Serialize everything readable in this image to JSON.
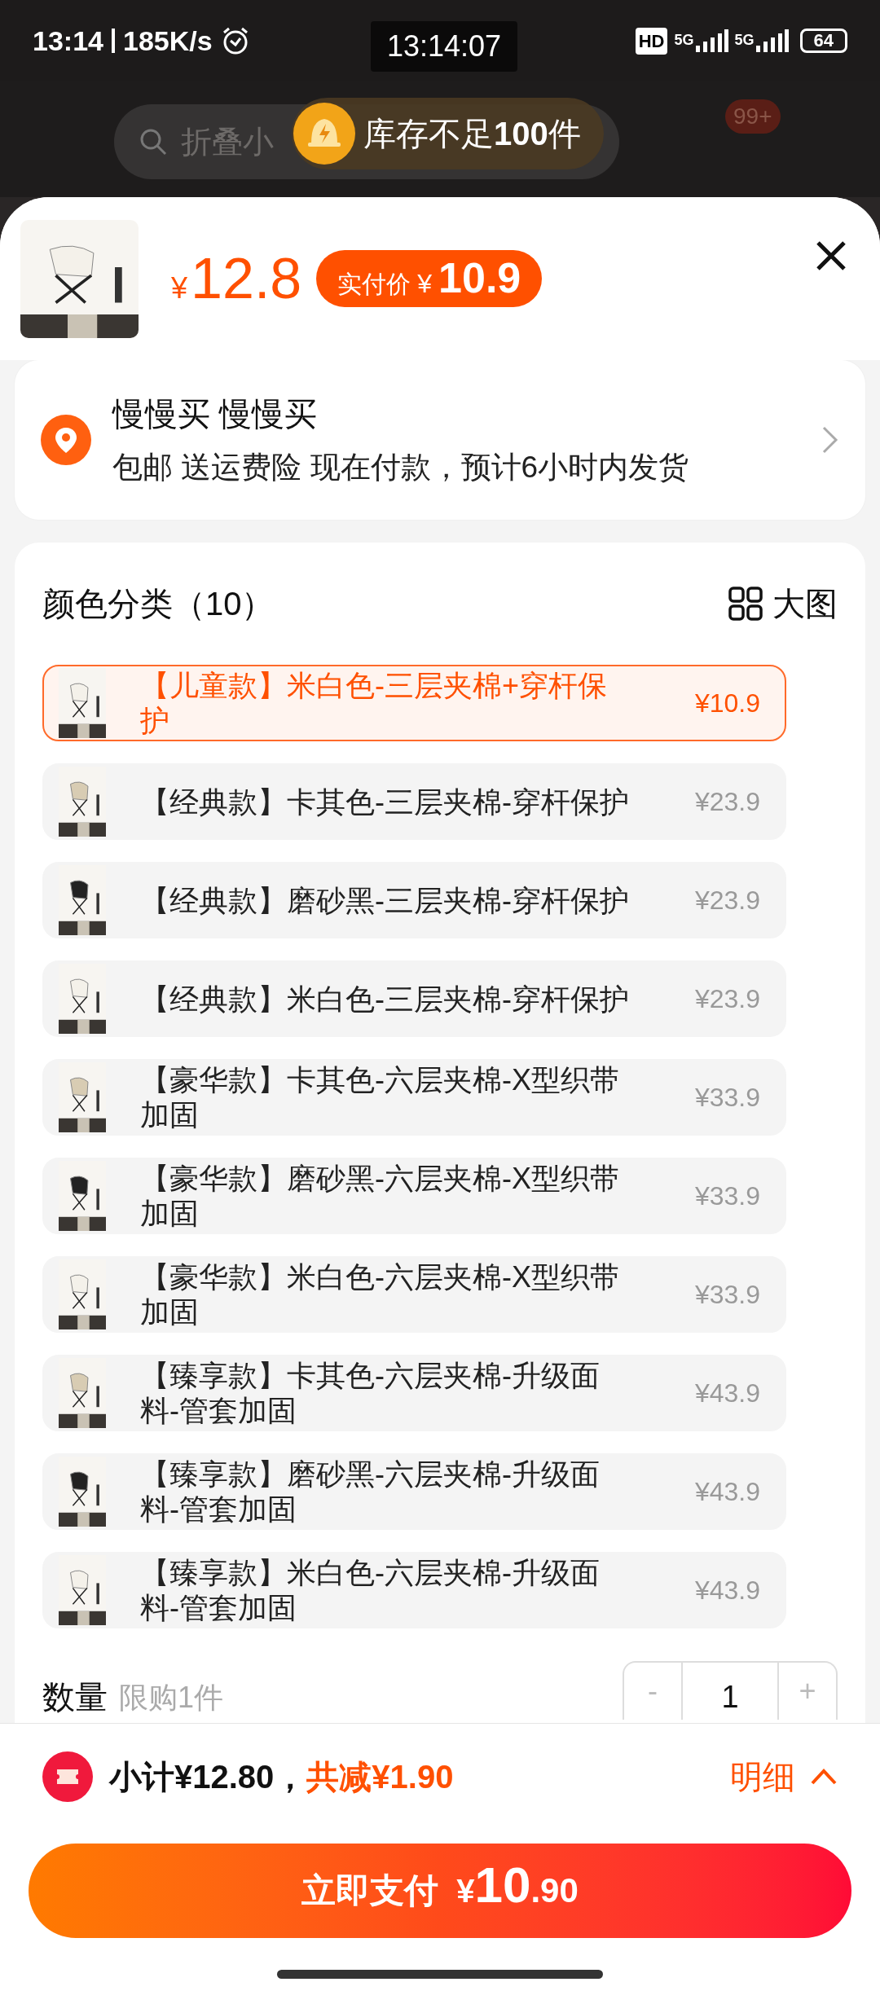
{
  "status_bar": {
    "time": "13:14",
    "speed": "185K/s",
    "clock": "13:14:07",
    "hd": "HD",
    "networks": [
      "5G",
      "5G"
    ],
    "battery": "64"
  },
  "background": {
    "search_text": "折叠小",
    "badge": "99+"
  },
  "toast": {
    "text": "库存不足**100**件"
  },
  "header": {
    "price_symbol": "¥",
    "price": "12.8",
    "actual_label": "实付价",
    "actual_symbol": "¥",
    "actual_price": "10.9"
  },
  "address": {
    "name": "慢慢买 慢慢买",
    "detail": "包邮 送运费险 现在付款，预计6小时内发货"
  },
  "options": {
    "title": "颜色分类（10）",
    "view_label": "大图",
    "items": [
      {
        "label": "【儿童款】米白色-三层夹棉+穿杆保护",
        "price": "¥10.9",
        "selected": true
      },
      {
        "label": "【经典款】卡其色-三层夹棉-穿杆保护",
        "price": "¥23.9",
        "selected": false
      },
      {
        "label": "【经典款】磨砂黑-三层夹棉-穿杆保护",
        "price": "¥23.9",
        "selected": false
      },
      {
        "label": "【经典款】米白色-三层夹棉-穿杆保护",
        "price": "¥23.9",
        "selected": false
      },
      {
        "label": "【豪华款】卡其色-六层夹棉-X型织带加固",
        "price": "¥33.9",
        "selected": false
      },
      {
        "label": "【豪华款】磨砂黑-六层夹棉-X型织带加固",
        "price": "¥33.9",
        "selected": false
      },
      {
        "label": "【豪华款】米白色-六层夹棉-X型织带加固",
        "price": "¥33.9",
        "selected": false
      },
      {
        "label": "【臻享款】卡其色-六层夹棉-升级面料-管套加固",
        "price": "¥43.9",
        "selected": false
      },
      {
        "label": "【臻享款】磨砂黑-六层夹棉-升级面料-管套加固",
        "price": "¥43.9",
        "selected": false
      },
      {
        "label": "【臻享款】米白色-六层夹棉-升级面料-管套加固",
        "price": "¥43.9",
        "selected": false
      }
    ]
  },
  "quantity": {
    "label": "数量",
    "limit": "限购1件",
    "minus": "-",
    "value": "1",
    "plus": "+"
  },
  "summary": {
    "subtotal": "小计¥12.80，",
    "discount": "共减¥1.90",
    "details": "明细"
  },
  "pay_button": {
    "label": "立即支付",
    "symbol": "¥",
    "integer": "10",
    "decimals": ".90"
  }
}
